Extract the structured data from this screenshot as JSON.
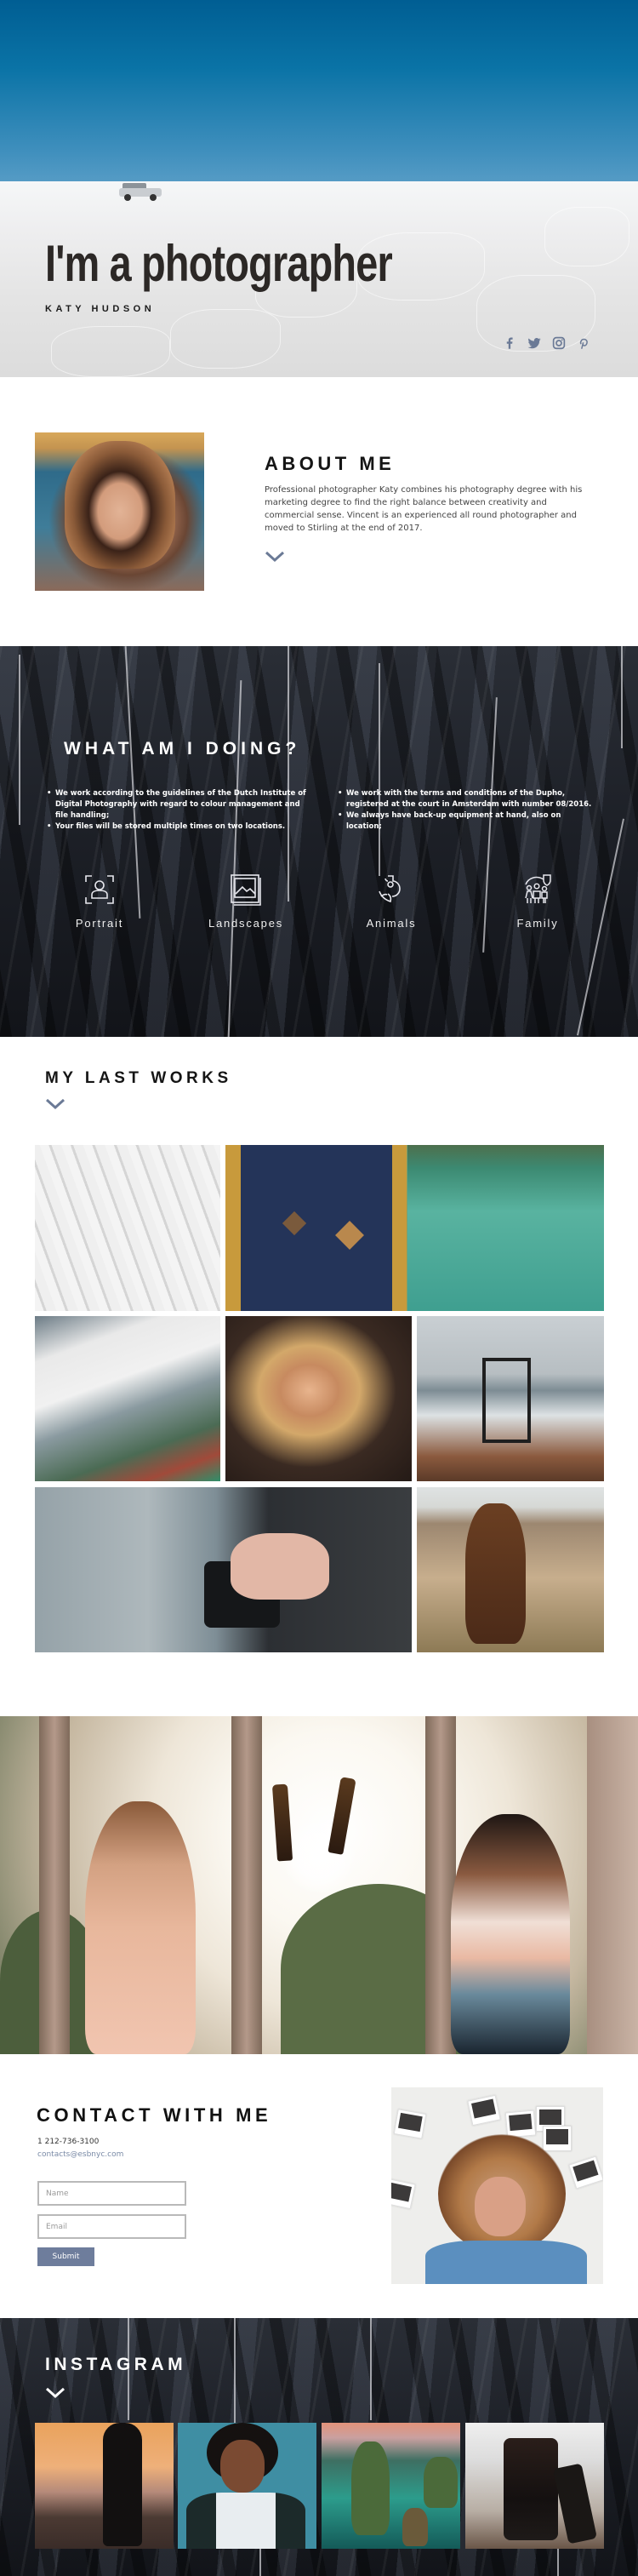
{
  "hero": {
    "title": "I'm a photographer",
    "subtitle": "KATY HUDSON",
    "social": [
      {
        "icon": "facebook-icon",
        "label": "Facebook"
      },
      {
        "icon": "twitter-icon",
        "label": "Twitter"
      },
      {
        "icon": "instagram-icon",
        "label": "Instagram"
      },
      {
        "icon": "pinterest-icon",
        "label": "Pinterest"
      }
    ],
    "icon_color": "#6b7a96"
  },
  "about": {
    "title": "ABOUT ME",
    "text": "Professional photographer Katy combines his photography degree with his marketing degree to find the right balance between creativity and commercial sense. Vincent is an experienced all round photographer and moved to Stirling at the end of 2017.",
    "chevron_icon": "chevron-down-icon"
  },
  "doing": {
    "title": "WHAT AM I DOING?",
    "list_left": [
      "We work according to the guidelines of the Dutch Institute of Digital Photography with regard to colour management and file handling;",
      "Your files will be stored multiple times on two locations."
    ],
    "list_right": [
      "We work with the terms and conditions of the Dupho, registered at the court in Amsterdam with number 08/2016.",
      "We always have back-up equipment at hand, also on location;"
    ],
    "services": [
      {
        "label": "Portrait",
        "icon": "portrait-icon"
      },
      {
        "label": "Landscapes",
        "icon": "landscape-icon"
      },
      {
        "label": "Animals",
        "icon": "animals-icon"
      },
      {
        "label": "Family",
        "icon": "family-icon"
      }
    ]
  },
  "works": {
    "title": "MY LAST WORKS",
    "tiles": [
      {
        "subject": "white feathers"
      },
      {
        "subject": "backpack in water"
      },
      {
        "subject": "city from above"
      },
      {
        "subject": "smiling woman"
      },
      {
        "subject": "camera rig at sea"
      },
      {
        "subject": "hands holding camera"
      },
      {
        "subject": "horses"
      }
    ]
  },
  "banner": {
    "subject": "two women toasting with bottles"
  },
  "contact": {
    "title": "CONTACT WITH ME",
    "phone": "1 212-736-3100",
    "email": "contacts@esbnyc.com",
    "name_placeholder": "Name",
    "name_value": "",
    "email_placeholder": "Email",
    "email_value": "",
    "submit_label": "Submit",
    "accent": "#6e7d9c"
  },
  "instagram": {
    "title": "INSTAGRAM",
    "photos": [
      {
        "subject": "cyclist at sunset"
      },
      {
        "subject": "portrait on teal"
      },
      {
        "subject": "sea cliffs"
      },
      {
        "subject": "camera lens"
      }
    ]
  }
}
